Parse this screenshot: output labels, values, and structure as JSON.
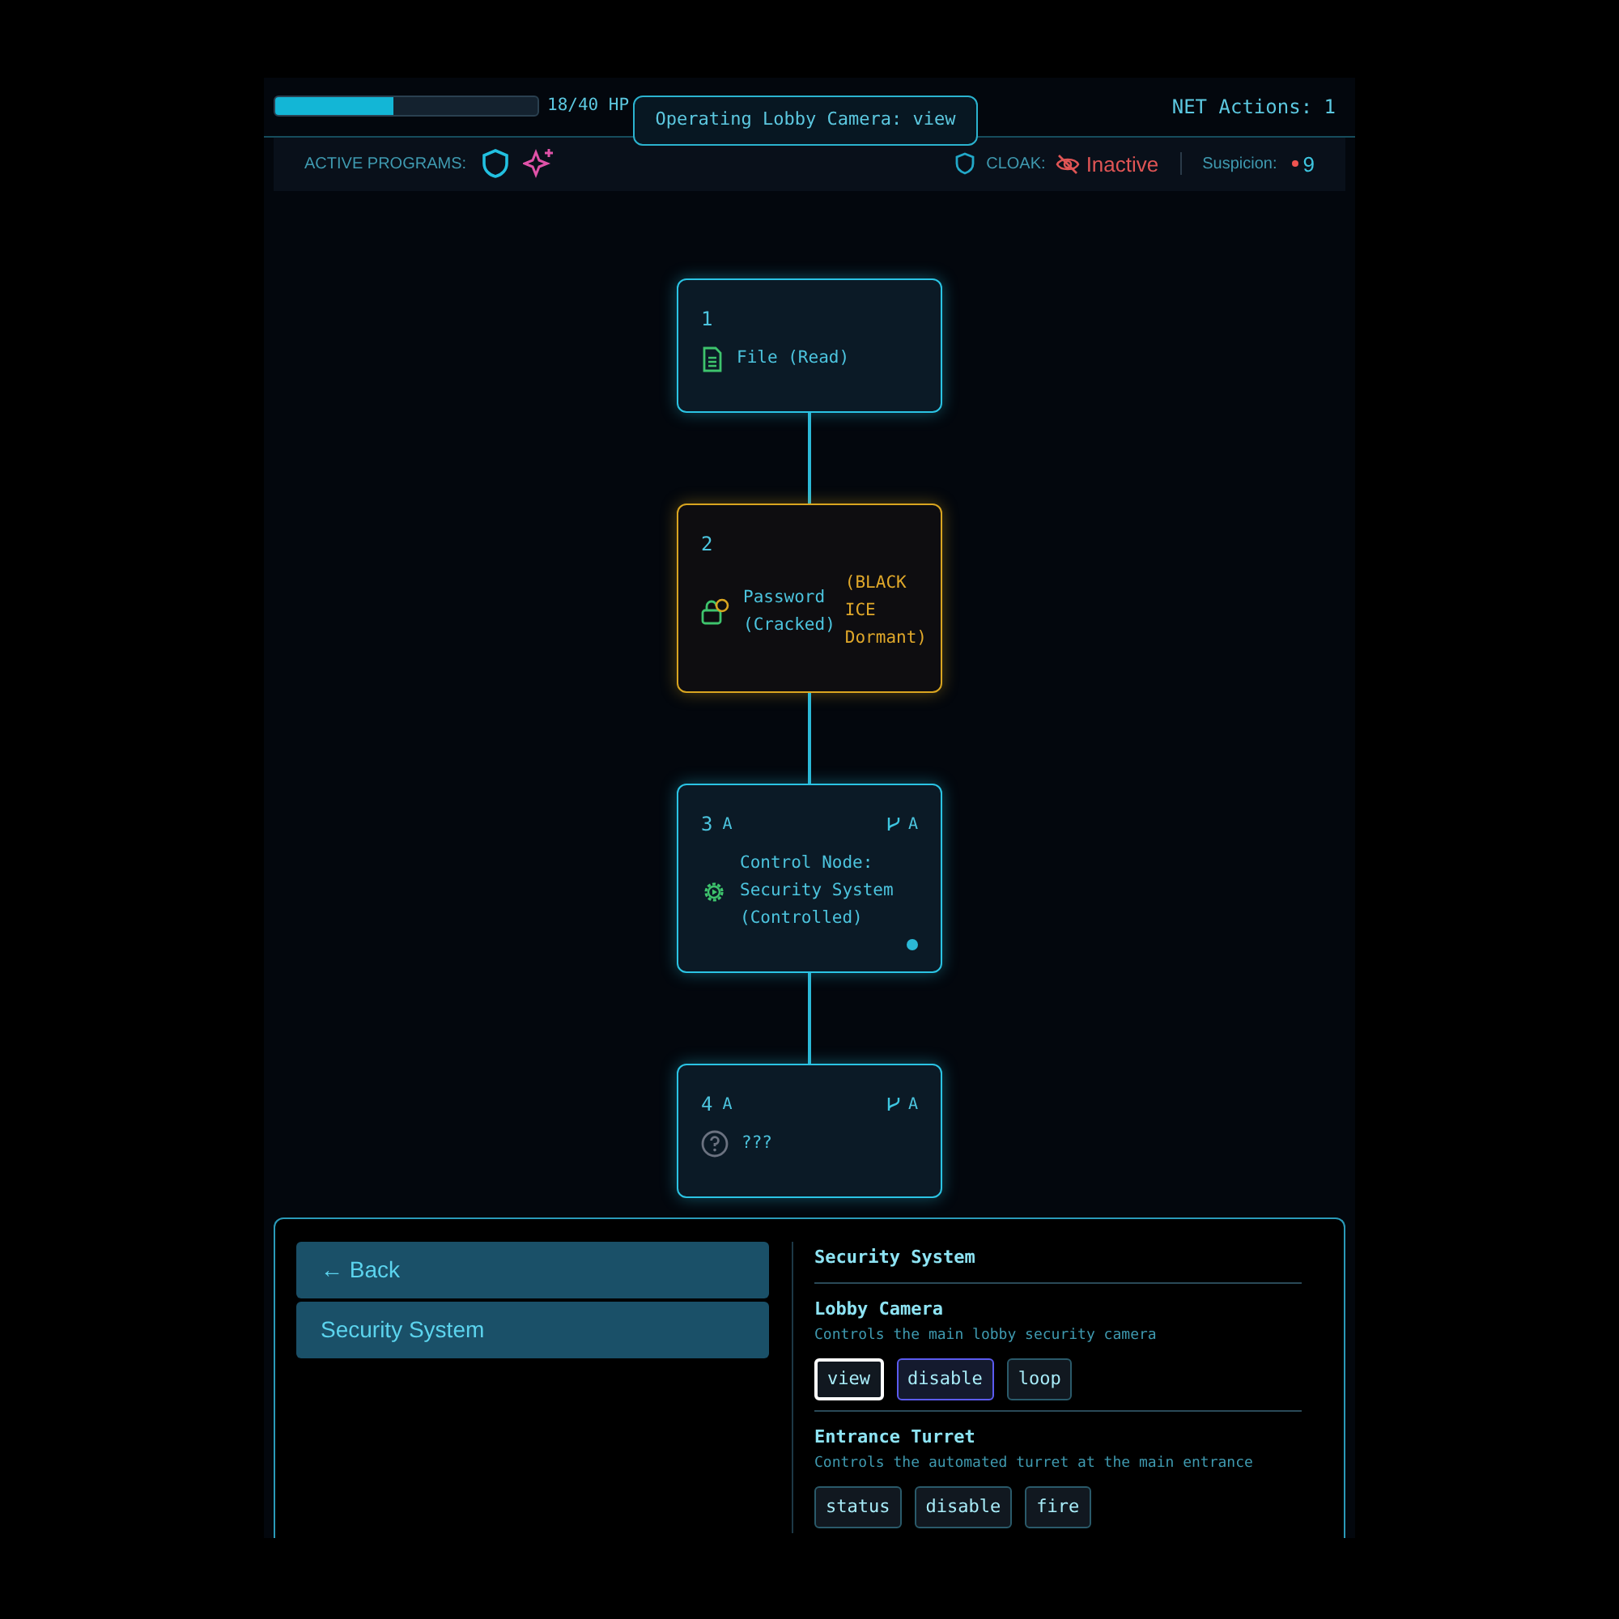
{
  "status": {
    "hp": {
      "level": 0.45,
      "reading": "18/40 HP"
    },
    "net_actions": "NET Actions: 1",
    "tooltip": "Operating Lobby Camera: view"
  },
  "programs": {
    "label": "ACTIVE PROGRAMS:",
    "cloak_label": "CLOAK:",
    "cloak_state": "Inactive",
    "cloak_active": false,
    "suspicion_label": "Suspicion:",
    "suspicion": "9"
  },
  "nodes": [
    {
      "kind": "file",
      "number": "1",
      "lines": [
        "File (Read)"
      ],
      "active": false
    },
    {
      "kind": "password",
      "number": "2",
      "lines": [
        "Password",
        "(Cracked)"
      ],
      "warning": [
        "(BLACK",
        "ICE",
        "Dormant)"
      ],
      "active": false
    },
    {
      "kind": "control",
      "number": "3",
      "tag": "A",
      "branch": "A",
      "lines": [
        "Control Node:",
        "Security System",
        "(Controlled)"
      ],
      "active": true
    },
    {
      "kind": "unknown",
      "number": "4",
      "tag": "A",
      "branch": "A",
      "lines": [
        "???"
      ],
      "active": false
    }
  ],
  "panel": {
    "menu": [
      {
        "label": "← Back"
      },
      {
        "label": "Security System"
      }
    ],
    "title": "Security System",
    "devices": [
      {
        "name": "Lobby Camera",
        "description": "Controls the main lobby security camera",
        "actions": [
          {
            "label": "view",
            "selected": true,
            "hovered": false
          },
          {
            "label": "disable",
            "selected": false,
            "hovered": true
          },
          {
            "label": "loop",
            "selected": false,
            "hovered": false
          }
        ]
      },
      {
        "name": "Entrance Turret",
        "description": "Controls the automated turret at the main entrance",
        "actions": [
          {
            "label": "status",
            "selected": false,
            "hovered": false
          },
          {
            "label": "disable",
            "selected": false,
            "hovered": false
          },
          {
            "label": "fire",
            "selected": false,
            "hovered": false
          }
        ]
      }
    ]
  }
}
